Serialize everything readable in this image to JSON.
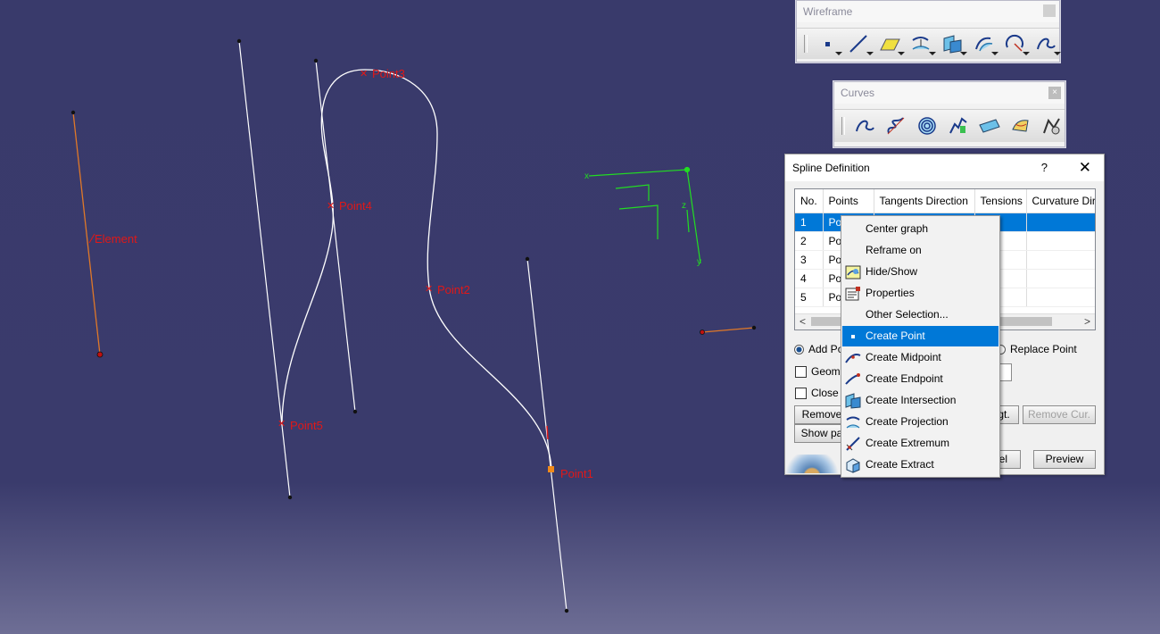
{
  "viewport": {
    "labels": {
      "element": "Element",
      "point1": "Point1",
      "point2": "Point2",
      "point3": "Point3",
      "point4": "Point4",
      "point5": "Point5"
    },
    "axis": {
      "x": "x",
      "y": "y",
      "z": "z"
    }
  },
  "wireframe_toolbar": {
    "title": "Wireframe",
    "icons": [
      "point-icon",
      "line-icon",
      "plane-icon",
      "projection-icon",
      "intersection-icon",
      "offset-icon",
      "circle-icon",
      "spline-icon"
    ]
  },
  "curves_toolbar": {
    "title": "Curves",
    "close": "×",
    "icons": [
      "spline-icon",
      "helix-icon",
      "spiral-icon",
      "spine-icon",
      "polyline-icon",
      "isoparametric-icon",
      "curve-smooth-icon"
    ]
  },
  "dialog": {
    "title": "Spline Definition",
    "help": "?",
    "close": "✕",
    "columns": [
      "No.",
      "Points",
      "Tangents Direction",
      "Tensions",
      "Curvature Dir"
    ],
    "rows": [
      {
        "no": "1",
        "point": "Poi"
      },
      {
        "no": "2",
        "point": "Poi"
      },
      {
        "no": "3",
        "point": "Poi"
      },
      {
        "no": "4",
        "point": "Poi"
      },
      {
        "no": "5",
        "point": "Poi"
      }
    ],
    "add_point": "Add Po",
    "replace_point": "Replace Point",
    "geometry_checkbox": "Geome",
    "close_checkbox": "Close S",
    "remove_button": "Remove",
    "remove_tgt_button": "gt.",
    "remove_cur_button": "Remove Cur.",
    "show_parameters_button": "Show pa",
    "cancel_button": "ncel",
    "preview_button": "Preview"
  },
  "context_menu": {
    "items": [
      {
        "label": "Center graph",
        "icon": ""
      },
      {
        "label": "Reframe on",
        "icon": ""
      },
      {
        "label": "Hide/Show",
        "icon": "hide-show-icon"
      },
      {
        "label": "Properties",
        "icon": "properties-icon"
      },
      {
        "label": "Other Selection...",
        "icon": ""
      },
      {
        "label": "Create Point",
        "icon": "point-icon"
      },
      {
        "label": "Create Midpoint",
        "icon": "midpoint-icon"
      },
      {
        "label": "Create Endpoint",
        "icon": "endpoint-icon"
      },
      {
        "label": "Create Intersection",
        "icon": "intersection-icon"
      },
      {
        "label": "Create Projection",
        "icon": "projection-icon"
      },
      {
        "label": "Create Extremum",
        "icon": "extremum-icon"
      },
      {
        "label": "Create Extract",
        "icon": "extract-icon"
      }
    ],
    "highlighted": "Create Point"
  },
  "colors": {
    "background_top": "#393a6b",
    "label_red": "#e01818",
    "curve_white": "#ffffff",
    "element_orange": "#e07828",
    "axis_green": "#22dd22",
    "selection_blue": "#0078d7"
  }
}
